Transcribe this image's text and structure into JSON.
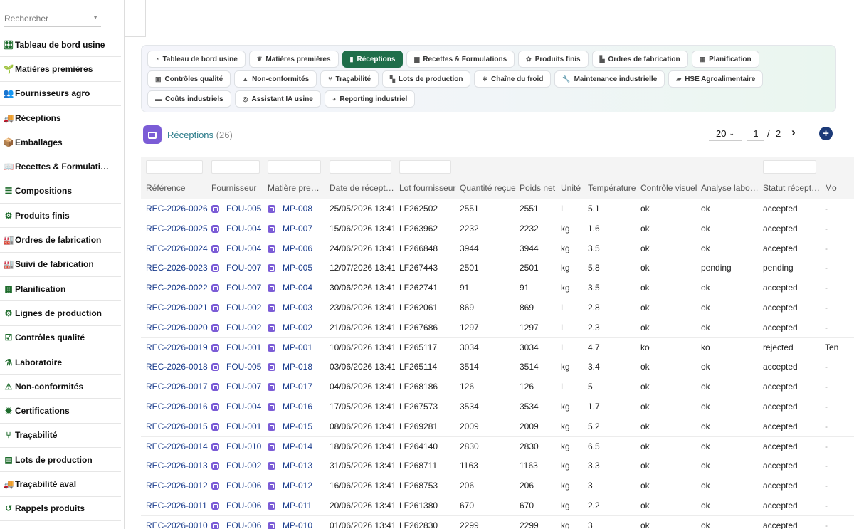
{
  "sidebar": {
    "search_placeholder": "Rechercher",
    "items": [
      {
        "label": "Tableau de bord usine",
        "icon": "🎛"
      },
      {
        "label": "Matières premières",
        "icon": "🌱"
      },
      {
        "label": "Fournisseurs agro",
        "icon": "👥"
      },
      {
        "label": "Réceptions",
        "icon": "🚚"
      },
      {
        "label": "Emballages",
        "icon": "📦"
      },
      {
        "label": "Recettes & Formulati…",
        "icon": "📖"
      },
      {
        "label": "Compositions",
        "icon": "☰"
      },
      {
        "label": "Produits finis",
        "icon": "⚙"
      },
      {
        "label": "Ordres de fabrication",
        "icon": "🏭"
      },
      {
        "label": "Suivi de fabrication",
        "icon": "🏭"
      },
      {
        "label": "Planification",
        "icon": "▦"
      },
      {
        "label": "Lignes de production",
        "icon": "⚙"
      },
      {
        "label": "Contrôles qualité",
        "icon": "☑"
      },
      {
        "label": "Laboratoire",
        "icon": "⚗"
      },
      {
        "label": "Non-conformités",
        "icon": "⚠"
      },
      {
        "label": "Certifications",
        "icon": "✹"
      },
      {
        "label": "Traçabilité",
        "icon": "⑂"
      },
      {
        "label": "Lots de production",
        "icon": "▤"
      },
      {
        "label": "Traçabilité aval",
        "icon": "🚚"
      },
      {
        "label": "Rappels produits",
        "icon": "↺"
      }
    ]
  },
  "module_tabs": [
    {
      "label": "Tableau de bord usine",
      "icon": "◔",
      "active": false
    },
    {
      "label": "Matières premières",
      "icon": "❦",
      "active": false
    },
    {
      "label": "Réceptions",
      "icon": "▮",
      "active": true
    },
    {
      "label": "Recettes & Formulations",
      "icon": "▆",
      "active": false
    },
    {
      "label": "Produits finis",
      "icon": "✿",
      "active": false
    },
    {
      "label": "Ordres de fabrication",
      "icon": "▙",
      "active": false
    },
    {
      "label": "Planification",
      "icon": "▦",
      "active": false
    },
    {
      "label": "Contrôles qualité",
      "icon": "▣",
      "active": false
    },
    {
      "label": "Non-conformités",
      "icon": "▲",
      "active": false
    },
    {
      "label": "Traçabilité",
      "icon": "⑂",
      "active": false
    },
    {
      "label": "Lots de production",
      "icon": "▚",
      "active": false
    },
    {
      "label": "Chaîne du froid",
      "icon": "✻",
      "active": false
    },
    {
      "label": "Maintenance industrielle",
      "icon": "🔧",
      "active": false
    },
    {
      "label": "HSE Agroalimentaire",
      "icon": "▰",
      "active": false
    },
    {
      "label": "Coûts industriels",
      "icon": "▬",
      "active": false
    },
    {
      "label": "Assistant IA usine",
      "icon": "◎",
      "active": false
    },
    {
      "label": "Reporting industriel",
      "icon": "◕",
      "active": false
    }
  ],
  "page": {
    "title": "Réceptions",
    "count": "(26)",
    "page_size": "20",
    "current_page": "1",
    "page_separator": "/",
    "total_pages": "2"
  },
  "table": {
    "columns": [
      "Référence",
      "Fournisseur",
      "Matière pre…",
      "Date de réceptio…",
      "Lot fournisseur",
      "Quantité reçue",
      "Poids net",
      "Unité",
      "Température",
      "Contrôle visuel",
      "Analyse labo…",
      "Statut récept…",
      "Mo"
    ],
    "rows": [
      [
        "REC-2026-0026",
        "FOU-005",
        "MP-008",
        "25/05/2026 13:41",
        "LF262502",
        "2551",
        "2551",
        "L",
        "5.1",
        "ok",
        "ok",
        "accepted",
        "-"
      ],
      [
        "REC-2026-0025",
        "FOU-004",
        "MP-007",
        "15/06/2026 13:41",
        "LF263962",
        "2232",
        "2232",
        "kg",
        "1.6",
        "ok",
        "ok",
        "accepted",
        "-"
      ],
      [
        "REC-2026-0024",
        "FOU-004",
        "MP-006",
        "24/06/2026 13:41",
        "LF266848",
        "3944",
        "3944",
        "kg",
        "3.5",
        "ok",
        "ok",
        "accepted",
        "-"
      ],
      [
        "REC-2026-0023",
        "FOU-007",
        "MP-005",
        "12/07/2026 13:41",
        "LF267443",
        "2501",
        "2501",
        "kg",
        "5.8",
        "ok",
        "pending",
        "pending",
        "-"
      ],
      [
        "REC-2026-0022",
        "FOU-007",
        "MP-004",
        "30/06/2026 13:41",
        "LF262741",
        "91",
        "91",
        "kg",
        "3.5",
        "ok",
        "ok",
        "accepted",
        "-"
      ],
      [
        "REC-2026-0021",
        "FOU-002",
        "MP-003",
        "23/06/2026 13:41",
        "LF262061",
        "869",
        "869",
        "L",
        "2.8",
        "ok",
        "ok",
        "accepted",
        "-"
      ],
      [
        "REC-2026-0020",
        "FOU-002",
        "MP-002",
        "21/06/2026 13:41",
        "LF267686",
        "1297",
        "1297",
        "L",
        "2.3",
        "ok",
        "ok",
        "accepted",
        "-"
      ],
      [
        "REC-2026-0019",
        "FOU-001",
        "MP-001",
        "10/06/2026 13:41",
        "LF265117",
        "3034",
        "3034",
        "L",
        "4.7",
        "ko",
        "ko",
        "rejected",
        "Ten"
      ],
      [
        "REC-2026-0018",
        "FOU-005",
        "MP-018",
        "03/06/2026 13:41",
        "LF265114",
        "3514",
        "3514",
        "kg",
        "3.4",
        "ok",
        "ok",
        "accepted",
        "-"
      ],
      [
        "REC-2026-0017",
        "FOU-007",
        "MP-017",
        "04/06/2026 13:41",
        "LF268186",
        "126",
        "126",
        "L",
        "5",
        "ok",
        "ok",
        "accepted",
        "-"
      ],
      [
        "REC-2026-0016",
        "FOU-004",
        "MP-016",
        "17/05/2026 13:41",
        "LF267573",
        "3534",
        "3534",
        "kg",
        "1.7",
        "ok",
        "ok",
        "accepted",
        "-"
      ],
      [
        "REC-2026-0015",
        "FOU-001",
        "MP-015",
        "08/06/2026 13:41",
        "LF269281",
        "2009",
        "2009",
        "kg",
        "5.2",
        "ok",
        "ok",
        "accepted",
        "-"
      ],
      [
        "REC-2026-0014",
        "FOU-010",
        "MP-014",
        "18/06/2026 13:41",
        "LF264140",
        "2830",
        "2830",
        "kg",
        "6.5",
        "ok",
        "ok",
        "accepted",
        "-"
      ],
      [
        "REC-2026-0013",
        "FOU-002",
        "MP-013",
        "31/05/2026 13:41",
        "LF268711",
        "1163",
        "1163",
        "kg",
        "3.3",
        "ok",
        "ok",
        "accepted",
        "-"
      ],
      [
        "REC-2026-0012",
        "FOU-006",
        "MP-012",
        "16/06/2026 13:41",
        "LF268753",
        "206",
        "206",
        "kg",
        "3",
        "ok",
        "ok",
        "accepted",
        "-"
      ],
      [
        "REC-2026-0011",
        "FOU-006",
        "MP-011",
        "20/06/2026 13:41",
        "LF261380",
        "670",
        "670",
        "kg",
        "2.2",
        "ok",
        "ok",
        "accepted",
        "-"
      ],
      [
        "REC-2026-0010",
        "FOU-006",
        "MP-010",
        "01/06/2026 13:41",
        "LF262830",
        "2299",
        "2299",
        "kg",
        "3",
        "ok",
        "ok",
        "accepted",
        "-"
      ]
    ]
  }
}
